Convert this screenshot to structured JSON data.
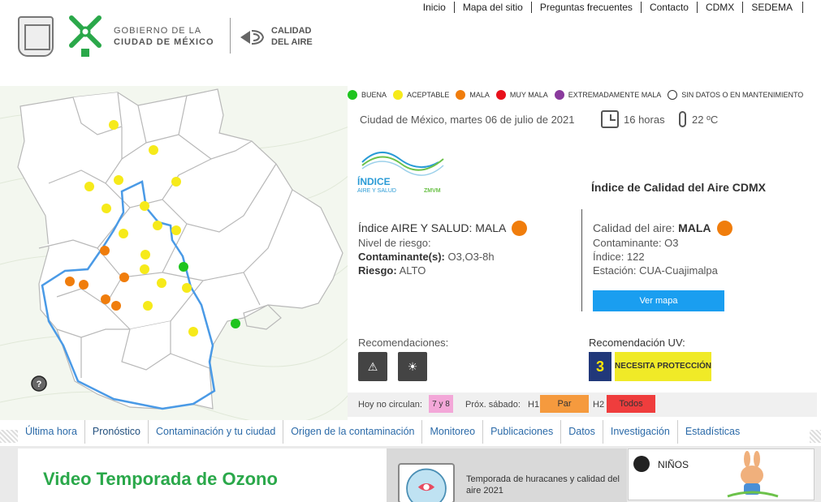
{
  "header": {
    "top_links": [
      "Inicio",
      "Mapa del sitio",
      "Preguntas frecuentes",
      "Contacto",
      "CDMX",
      "SEDEMA"
    ],
    "gov_line1": "GOBIERNO DE LA",
    "gov_line2": "CIUDAD DE MÉXICO",
    "aire_line1": "CALIDAD",
    "aire_line2": "DEL AIRE"
  },
  "legend": [
    {
      "label": "BUENA",
      "color": "#1fc41f"
    },
    {
      "label": "ACEPTABLE",
      "color": "#f6ea1a"
    },
    {
      "label": "MALA",
      "color": "#f07d0c"
    },
    {
      "label": "MUY MALA",
      "color": "#e8101b"
    },
    {
      "label": "EXTREMADAMENTE MALA",
      "color": "#8a3a9d"
    },
    {
      "label": "SIN DATOS O EN MANTENIMIENTO",
      "color": "#ffffff"
    }
  ],
  "status": {
    "date": "Ciudad de México, martes 06 de julio de 2021",
    "hour": "16 horas",
    "temperature": "22 ºC"
  },
  "indice": {
    "logo_line1": "ÍNDICE",
    "logo_line2": "AIRE Y SALUD",
    "logo_tag": "ZMVM",
    "title": "Índice de Calidad del Aire CDMX"
  },
  "aire_salud": {
    "label": "Índice AIRE Y SALUD:",
    "value": "MALA",
    "nivel": "Nivel de riesgo:",
    "contaminante_label": "Contaminante(s):",
    "contaminante_value": "O3,O3-8h",
    "riesgo_label": "Riesgo:",
    "riesgo_value": "ALTO"
  },
  "calidad": {
    "label": "Calidad del aire:",
    "value": "MALA",
    "contaminante": "Contaminante: O3",
    "indice": "Índice: 122",
    "estacion": "Estación: CUA-Cuajimalpa",
    "button": "Ver mapa"
  },
  "recomendaciones": {
    "label": "Recomendaciones:",
    "uv_label": "Recomendación UV:",
    "uv_index": "3",
    "uv_text": "NECESITA PROTECCIÓN"
  },
  "hoy_no_circula": {
    "label": "Hoy no circulan:",
    "value": "7 y 8",
    "prox_label": "Próx. sábado:",
    "h1_label": "H1",
    "h1_value": "Par",
    "h2_label": "H2",
    "h2_value": "Todos"
  },
  "nav": [
    "Última hora",
    "Pronóstico",
    "Contaminación y tu ciudad",
    "Origen de la contaminación",
    "Monitoreo",
    "Publicaciones",
    "Datos",
    "Investigación",
    "Estadísticas"
  ],
  "bottom": {
    "video_title": "Video Temporada de Ozono",
    "hurricane_text": "Temporada de huracanes y calidad del aire 2021",
    "ninos_label": "NIÑOS"
  },
  "map_stations": [
    {
      "status": "aceptable"
    },
    {
      "status": "aceptable"
    },
    {
      "status": "aceptable"
    },
    {
      "status": "aceptable"
    },
    {
      "status": "aceptable"
    },
    {
      "status": "aceptable"
    },
    {
      "status": "aceptable"
    },
    {
      "status": "aceptable"
    },
    {
      "status": "aceptable"
    },
    {
      "status": "aceptable"
    },
    {
      "status": "aceptable"
    },
    {
      "status": "aceptable"
    },
    {
      "status": "aceptable"
    },
    {
      "status": "aceptable"
    },
    {
      "status": "aceptable"
    },
    {
      "status": "aceptable"
    },
    {
      "status": "mala"
    },
    {
      "status": "mala"
    },
    {
      "status": "mala"
    },
    {
      "status": "mala"
    },
    {
      "status": "mala"
    },
    {
      "status": "mala"
    },
    {
      "status": "buena"
    },
    {
      "status": "buena"
    },
    {
      "status": "sin_datos"
    }
  ]
}
